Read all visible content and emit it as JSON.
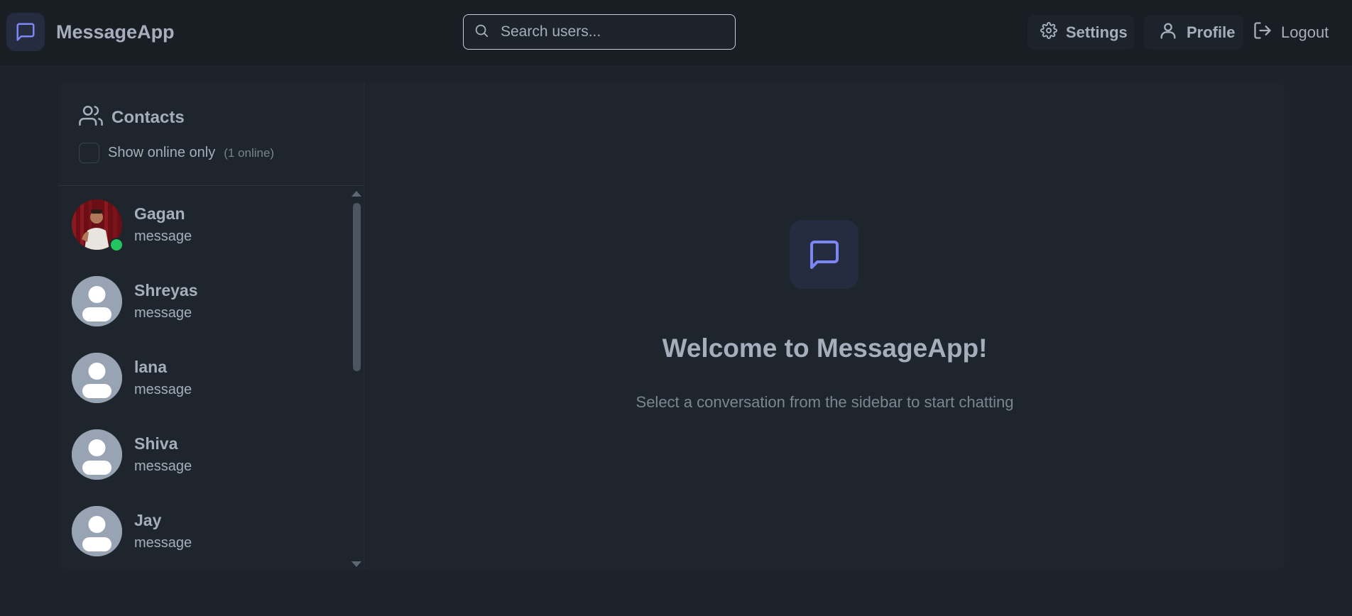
{
  "app": {
    "name": "MessageApp",
    "logo_icon": "chat-bubble-icon",
    "accent_color": "#7c86f5"
  },
  "search": {
    "placeholder": "Search users...",
    "value": "",
    "icon": "search-icon"
  },
  "nav": {
    "settings_label": "Settings",
    "profile_label": "Profile",
    "logout_label": "Logout"
  },
  "sidebar": {
    "title": "Contacts",
    "filter_label": "Show online only",
    "filter_checked": false,
    "online_count": "(1 online)",
    "contacts": [
      {
        "name": "Gagan",
        "message": "message",
        "online": true,
        "avatar": "photo"
      },
      {
        "name": "Shreyas",
        "message": "message",
        "online": false,
        "avatar": "default"
      },
      {
        "name": "lana",
        "message": "message",
        "online": false,
        "avatar": "default"
      },
      {
        "name": "Shiva",
        "message": "message",
        "online": false,
        "avatar": "default"
      },
      {
        "name": "Jay",
        "message": "message",
        "online": false,
        "avatar": "default"
      }
    ]
  },
  "welcome": {
    "title": "Welcome to MessageApp!",
    "subtitle": "Select a conversation from the sidebar to start chatting"
  }
}
